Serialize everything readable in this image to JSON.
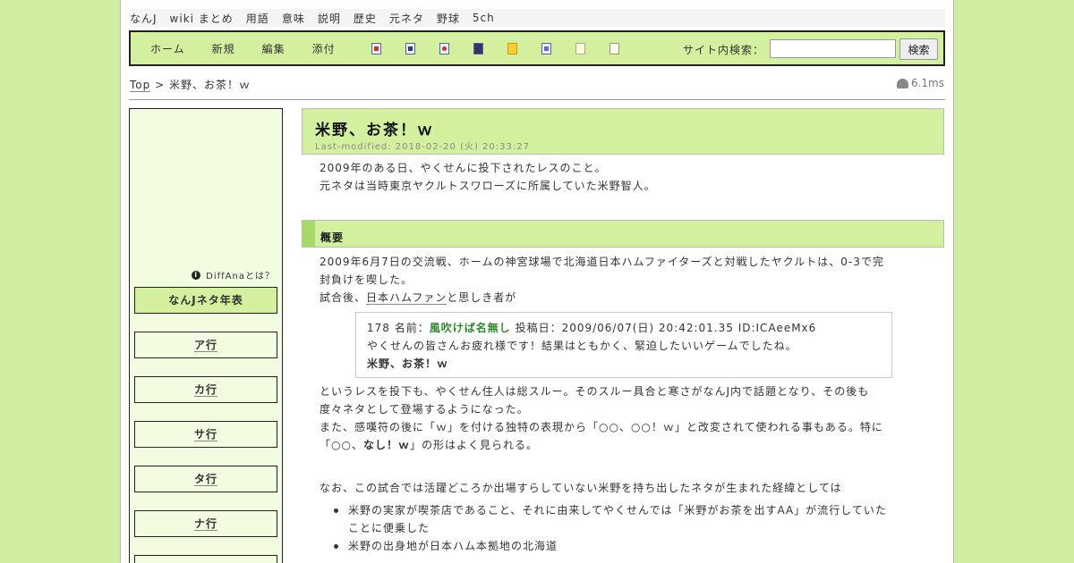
{
  "topnav": [
    "なんJ",
    "wiki まとめ",
    "用語",
    "意味",
    "説明",
    "歴史",
    "元ネタ",
    "野球",
    "5ch"
  ],
  "toolbar": {
    "buttons": [
      "ホーム",
      "新規",
      "編集",
      "添付"
    ],
    "icons": [
      "copy-icon",
      "search-page-icon",
      "delete-icon",
      "save-icon",
      "lock-icon",
      "list-icon",
      "page-icon",
      "help-icon"
    ],
    "search_label": "サイト内検索：",
    "search_value": "",
    "search_button": "検索"
  },
  "breadcrumb": {
    "top": "Top",
    "sep": ">",
    "current": "米野、お茶！ｗ"
  },
  "timing": "6.1ms",
  "sidebar": {
    "diffana": "DiffAnaとは？",
    "main_item": "なんJネタ年表",
    "items": [
      "ア行",
      "カ行",
      "サ行",
      "タ行",
      "ナ行"
    ]
  },
  "article": {
    "title": "米野、お茶！ｗ",
    "last_modified": "Last-modified: 2018-02-20 (火) 20:33:27",
    "intro": [
      "2009年のある日、やくせんに投下されたレスのこと。",
      "元ネタは当時東京ヤクルトスワローズに所属していた米野智人。"
    ],
    "section_heading": "概要",
    "para1_line1": "2009年6月7日の交流戦、ホームの神宮球場で北海道日本ハムファイターズと対戦したヤクルトは、0-3で完",
    "para1_line2": "封負けを喫した。",
    "para2_link": "日本ハムファン",
    "para2_pre": "試合後、",
    "para2_post": "と思しき者が",
    "quote": {
      "header_pre": "178 名前：",
      "name": "風吹けば名無し",
      "header_post": " 投稿日：2009/06/07(日) 20:42:01.35 ID:ICAeeMx6",
      "line1": "やくせんの皆さんお疲れ様です！結果はともかく、緊迫したいいゲームでしたね。",
      "line2": "米野、お茶！ｗ"
    },
    "para3_line1": "というレスを投下も、やくせん住人は総スルー。そのスルー具合と寒さがなんJ内で話題となり、その後も",
    "para3_line2": "度々ネタとして登場するようになった。",
    "para4_line1": "また、感嘆符の後に「ｗ」を付ける独特の表現から「○○、○○！ｗ」と改変されて使われる事もある。特に",
    "para4_line2_pre": "「○○、",
    "para4_line2_bold": "なし！ｗ",
    "para4_line2_post": "」の形はよく見られる。",
    "para5": "なお、この試合では活躍どころか出場すらしていない米野を持ち出したネタが生まれた経緯としては",
    "bullets": [
      "米野の実家が喫茶店であること、それに由来してやくせんでは「米野がお茶を出すAA」が流行していた",
      "米野の出身地が日本ハム本拠地の北海道"
    ],
    "bullet1_cont": "ことに便乗した"
  }
}
